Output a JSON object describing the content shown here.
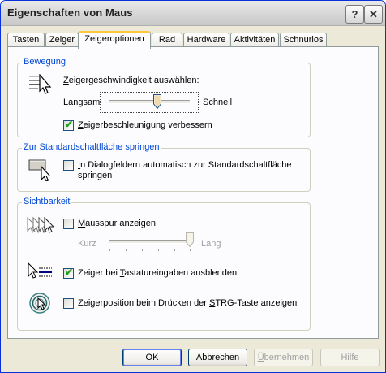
{
  "window": {
    "title": "Eigenschaften von Maus",
    "help_glyph": "?",
    "close_glyph": "✕"
  },
  "tabs": [
    {
      "label": "Tasten"
    },
    {
      "label": "Zeiger"
    },
    {
      "label": "Zeigeroptionen",
      "active": true
    },
    {
      "label": "Rad"
    },
    {
      "label": "Hardware"
    },
    {
      "label": "Aktivitäten"
    },
    {
      "label": "Schnurlos"
    }
  ],
  "motion": {
    "group_label": "Bewegung",
    "speed_prefix": "Z",
    "speed_label": "eigergeschwindigkeit auswählen:",
    "slow_label": "Langsam",
    "fast_label": "Schnell",
    "speed_value_fraction": 0.6,
    "accel_prefix": "Z",
    "accel_label": "eigerbeschleunigung verbessern",
    "accel_checked": true
  },
  "snapto": {
    "group_label": "Zur Standardschaltfläche springen",
    "label_prefix": "I",
    "label_line1": "n Dialogfeldern automatisch zur Standardschaltfläche",
    "label_line2": "springen",
    "checked": false
  },
  "visibility": {
    "group_label": "Sichtbarkeit",
    "trails_prefix": "M",
    "trails_label": "ausspur anzeigen",
    "trails_checked": false,
    "short_label": "Kurz",
    "long_label": "Lang",
    "trails_value_fraction": 1.0,
    "hide_label_a": "Zeiger bei ",
    "hide_prefix": "T",
    "hide_label_b": "astatureingaben ausblenden",
    "hide_checked": true,
    "ctrl_label_a": "Zeigerposition beim Drücken der ",
    "ctrl_prefix": "S",
    "ctrl_label_b": "TRG-Taste anzeigen",
    "ctrl_checked": false
  },
  "buttons": {
    "ok": "OK",
    "cancel": "Abbrechen",
    "apply_prefix": "Ü",
    "apply": "bernehmen",
    "help": "Hilfe"
  },
  "icons": {
    "pointer_speed": "pointer-speed-icon",
    "snap_to": "snap-to-default-icon",
    "trails": "pointer-trails-icon",
    "hide": "hide-pointer-icon",
    "ctrl_locate": "locate-pointer-icon"
  },
  "colors": {
    "accent_blue": "#0046d5",
    "check_green": "#21a121",
    "tab_highlight": "#ffc83c"
  }
}
